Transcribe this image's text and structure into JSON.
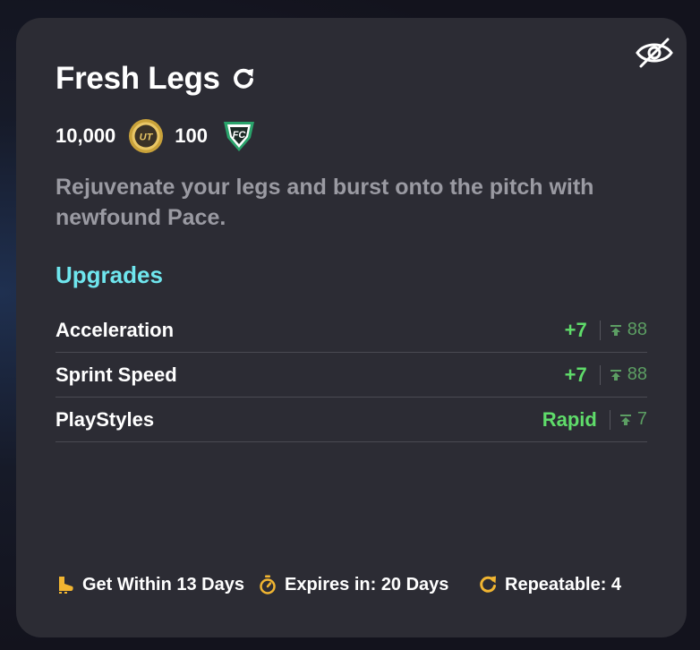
{
  "objective": {
    "title": "Fresh Legs",
    "coins": "10,000",
    "fc_points": "100",
    "description": "Rejuvenate your legs and burst onto the pitch with newfound Pace."
  },
  "upgrades": {
    "heading": "Upgrades",
    "items": [
      {
        "label": "Acceleration",
        "value": "+7",
        "cap": "88"
      },
      {
        "label": "Sprint Speed",
        "value": "+7",
        "cap": "88"
      },
      {
        "label": "PlayStyles",
        "value": "Rapid",
        "cap": "7"
      }
    ]
  },
  "footer": {
    "get_within": "Get Within 13 Days",
    "expires": "Expires in: 20 Days",
    "repeatable": "Repeatable: 4"
  },
  "icons": {
    "hide": "eye-slash-icon",
    "repeat": "refresh-icon",
    "coin": "ut-coin-icon",
    "points": "fc-points-icon",
    "cap": "max-cap-icon",
    "get_within": "boot-icon",
    "expires": "stopwatch-icon",
    "repeatable": "repeat-icon"
  },
  "colors": {
    "card_bg": "#2c2c34",
    "heading_cyan": "#6fe6ee",
    "upgrade_green": "#5fdc6a",
    "cap_green": "#5c9e63",
    "footer_icon_gold": "#f1b531"
  }
}
